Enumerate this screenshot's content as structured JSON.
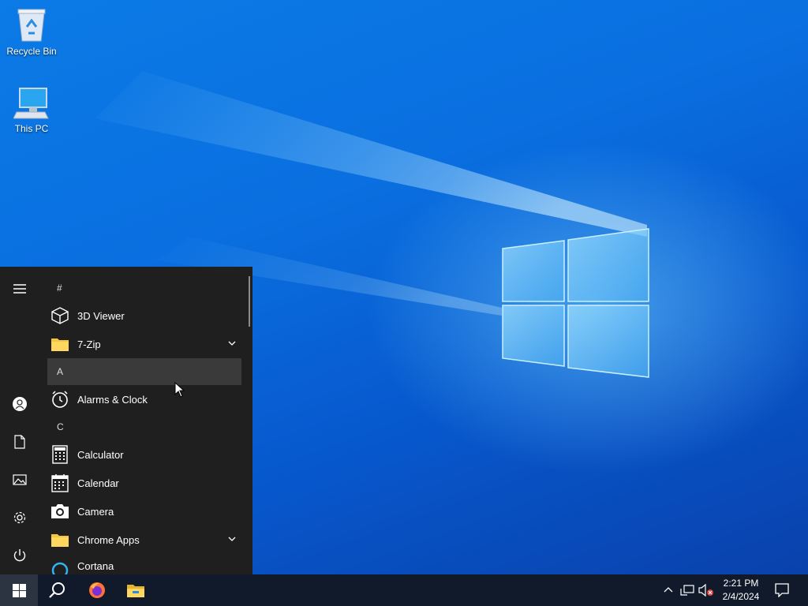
{
  "desktop": {
    "icons": [
      {
        "label": "Recycle Bin",
        "icon": "recycle-bin-icon"
      },
      {
        "label": "This PC",
        "icon": "computer-icon"
      }
    ]
  },
  "start_menu": {
    "rail": [
      {
        "name": "menu-icon"
      },
      {
        "name": "user-account-icon"
      },
      {
        "name": "documents-icon"
      },
      {
        "name": "pictures-icon"
      },
      {
        "name": "settings-gear-icon"
      },
      {
        "name": "power-icon"
      }
    ],
    "sections": {
      "hash": "#",
      "a": "A",
      "c": "C"
    },
    "apps": {
      "viewer3d": "3D Viewer",
      "zip7": "7-Zip",
      "alarms": "Alarms & Clock",
      "calculator": "Calculator",
      "calendar": "Calendar",
      "camera": "Camera",
      "chrome_apps": "Chrome Apps",
      "cortana": "Cortana"
    }
  },
  "taskbar": {
    "items": [
      "start-windows-icon",
      "search-icon",
      "firefox-icon",
      "file-explorer-icon"
    ],
    "tray": [
      "show-hidden-icons-chevron",
      "network-icon",
      "volume-muted-icon",
      "notifications-icon"
    ],
    "time": "2:21 PM",
    "date": "2/4/2024"
  },
  "colors": {
    "accent": "#0a6fe0",
    "menu_bg": "#1f1f1f",
    "taskbar_bg": "#101a2a"
  }
}
